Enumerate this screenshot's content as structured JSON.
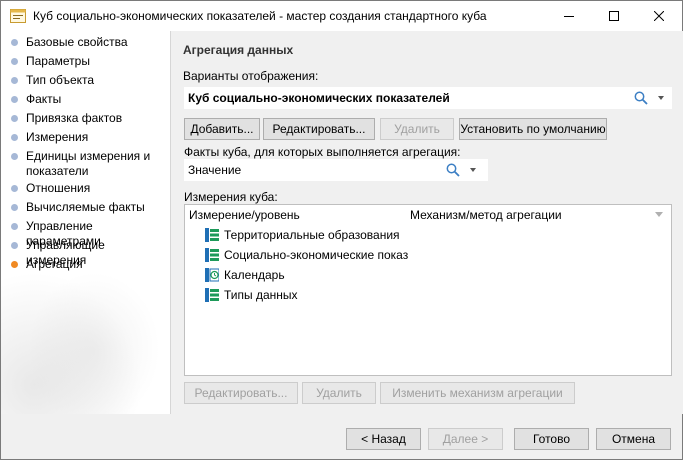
{
  "window": {
    "title": "Куб социально-экономических показателей - мастер создания стандартного куба"
  },
  "sidebar": {
    "items": [
      {
        "label": "Базовые свойства",
        "active": false
      },
      {
        "label": "Параметры",
        "active": false
      },
      {
        "label": "Тип объекта",
        "active": false
      },
      {
        "label": "Факты",
        "active": false
      },
      {
        "label": "Привязка фактов",
        "active": false
      },
      {
        "label": "Измерения",
        "active": false
      },
      {
        "label": "Единицы измерения и показатели",
        "active": false
      },
      {
        "label": "Отношения",
        "active": false
      },
      {
        "label": "Вычисляемые факты",
        "active": false
      },
      {
        "label": "Управление параметрами",
        "active": false
      },
      {
        "label": "Управляющие измерения",
        "active": false
      },
      {
        "label": "Агрегация",
        "active": true
      }
    ]
  },
  "main": {
    "section_title": "Агрегация данных",
    "variants_label": "Варианты отображения:",
    "variants_value": "Куб социально-экономических показателей",
    "buttons": {
      "add": "Добавить...",
      "edit": "Редактировать...",
      "delete": "Удалить",
      "set_default": "Установить по умолчанию"
    },
    "facts_label": "Факты куба, для которых выполняется агрегация:",
    "facts_value": "Значение",
    "dimensions_label": "Измерения куба:",
    "table": {
      "columns": [
        "Измерение/уровень",
        "Механизм/метод агрегации"
      ],
      "rows": [
        {
          "name": "Территориальные образования",
          "icon": "dimension-icon"
        },
        {
          "name": "Социально-экономические показ",
          "icon": "dimension-icon"
        },
        {
          "name": "Календарь",
          "icon": "calendar-dimension-icon"
        },
        {
          "name": "Типы данных",
          "icon": "dimension-icon"
        }
      ]
    },
    "bottom_buttons": {
      "edit": "Редактировать...",
      "delete": "Удалить",
      "change_mechanism": "Изменить механизм агрегации"
    }
  },
  "footer": {
    "back": "< Назад",
    "next": "Далее >",
    "finish": "Готово",
    "cancel": "Отмена"
  },
  "colors": {
    "nav_dot": "#a6b8d6",
    "nav_dot_active": "#f08a24",
    "dimension_icon_blue": "#1f6fb5",
    "dimension_icon_green": "#1e9a5a"
  }
}
